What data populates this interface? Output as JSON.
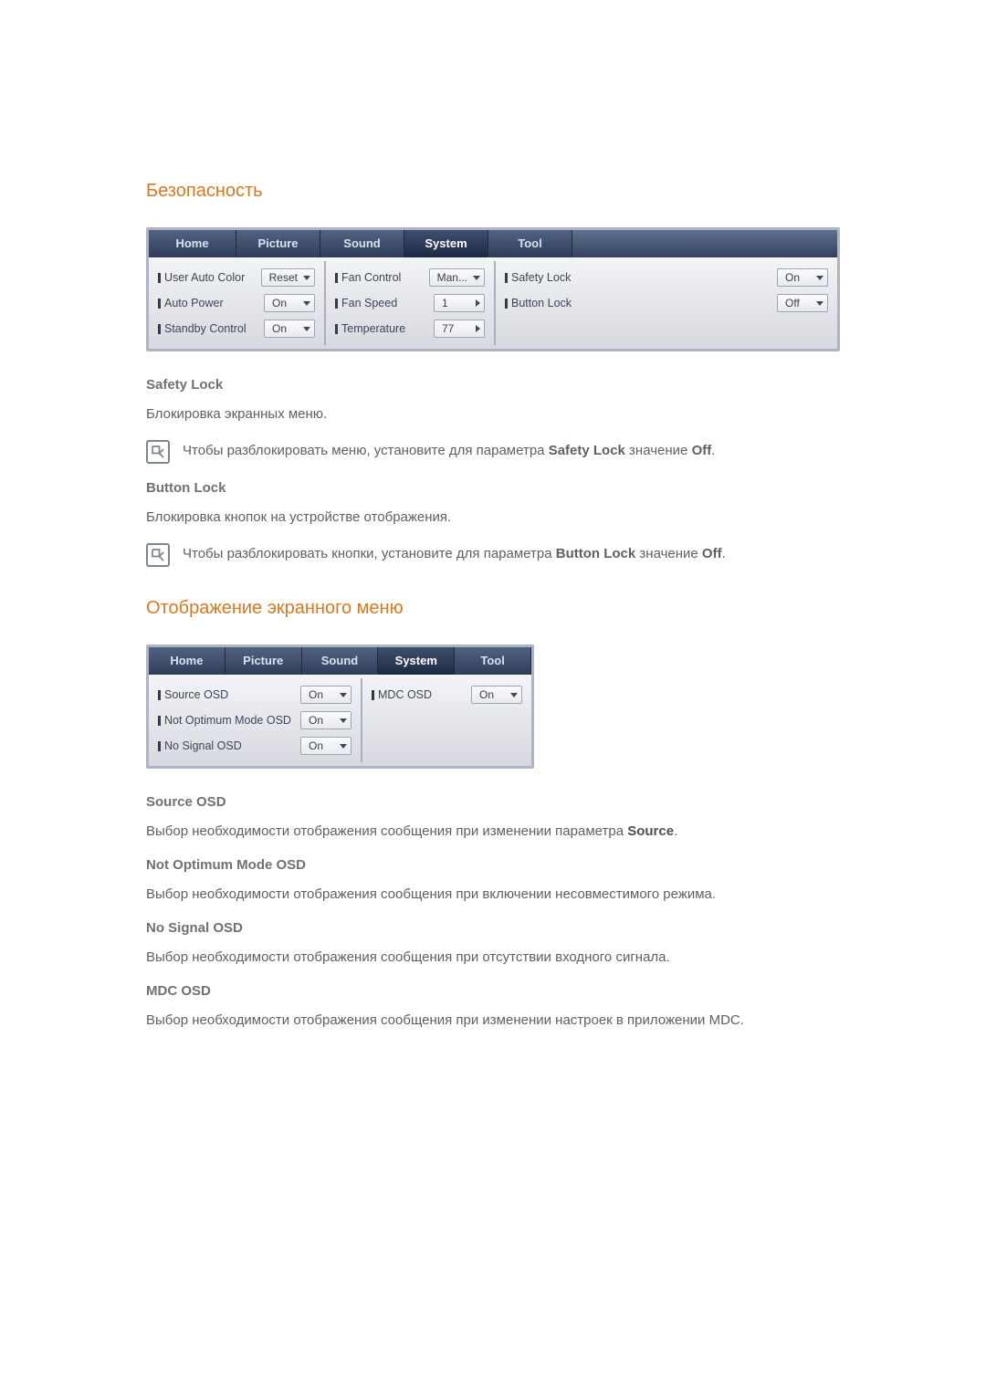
{
  "sections": {
    "security_title": "Безопасность",
    "osd_title": "Отображение экранного меню"
  },
  "tabs": {
    "home": "Home",
    "picture": "Picture",
    "sound": "Sound",
    "system": "System",
    "tool": "Tool"
  },
  "panel_security": {
    "col1": {
      "user_auto_color": {
        "label": "User Auto Color",
        "value": "Reset"
      },
      "auto_power": {
        "label": "Auto Power",
        "value": "On"
      },
      "standby_control": {
        "label": "Standby Control",
        "value": "On"
      }
    },
    "col2": {
      "fan_control": {
        "label": "Fan Control",
        "value": "Man..."
      },
      "fan_speed": {
        "label": "Fan Speed",
        "value": "1"
      },
      "temperature": {
        "label": "Temperature",
        "value": "77"
      }
    },
    "col3": {
      "safety_lock": {
        "label": "Safety Lock",
        "value": "On"
      },
      "button_lock": {
        "label": "Button Lock",
        "value": "Off"
      }
    }
  },
  "panel_osd": {
    "col1": {
      "source_osd": {
        "label": "Source OSD",
        "value": "On"
      },
      "not_optimum": {
        "label": "Not Optimum Mode OSD",
        "value": "On"
      },
      "no_signal": {
        "label": "No Signal OSD",
        "value": "On"
      }
    },
    "col2": {
      "mdc_osd": {
        "label": "MDC OSD",
        "value": "On"
      }
    }
  },
  "doc": {
    "safety_lock_h": "Safety Lock",
    "safety_lock_p": "Блокировка экранных меню.",
    "safety_lock_note_pre": "Чтобы разблокировать меню, установите для параметра ",
    "safety_lock_note_b1": "Safety Lock",
    "safety_lock_note_mid": " значение ",
    "safety_lock_note_b2": "Off",
    "safety_lock_note_post": ".",
    "button_lock_h": "Button Lock",
    "button_lock_p": "Блокировка кнопок на устройстве отображения.",
    "button_lock_note_pre": "Чтобы разблокировать кнопки, установите для параметра ",
    "button_lock_note_b1": "Button Lock",
    "button_lock_note_mid": " значение ",
    "button_lock_note_b2": "Off",
    "button_lock_note_post": ".",
    "source_osd_h": "Source OSD",
    "source_osd_p_pre": "Выбор необходимости отображения сообщения при изменении параметра ",
    "source_osd_p_b": "Source",
    "source_osd_p_post": ".",
    "not_optimum_h": "Not Optimum Mode OSD",
    "not_optimum_p": "Выбор необходимости отображения сообщения при включении несовместимого режима.",
    "no_signal_h": "No Signal OSD",
    "no_signal_p": "Выбор необходимости отображения сообщения при отсутствии входного сигнала.",
    "mdc_osd_h": "MDC OSD",
    "mdc_osd_p": "Выбор необходимости отображения сообщения при изменении настроек в приложении MDC."
  }
}
